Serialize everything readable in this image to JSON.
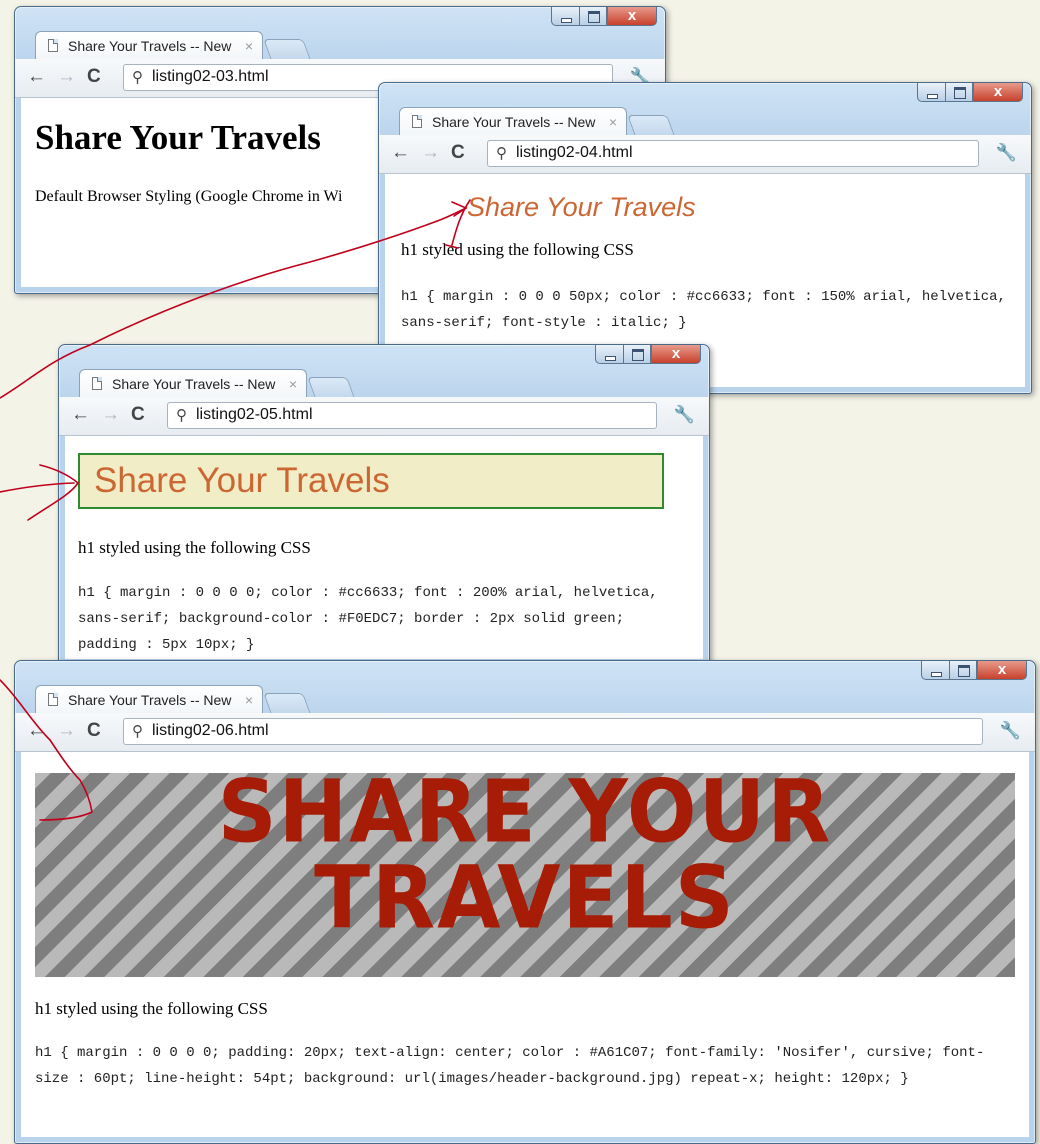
{
  "windows": [
    {
      "tab_title": "Share Your Travels -- New",
      "url": "listing02-03.html",
      "heading": "Share Your Travels",
      "text": "Default Browser Styling (Google Chrome in Wi"
    },
    {
      "tab_title": "Share Your Travels -- New",
      "url": "listing02-04.html",
      "heading": "Share Your Travels",
      "text": "h1 styled using the following CSS",
      "css": "h1 { margin : 0 0 0 50px; color : #cc6633; font : 150% arial, helvetica, sans-serif; font-style : italic; }"
    },
    {
      "tab_title": "Share Your Travels -- New",
      "url": "listing02-05.html",
      "heading": "Share Your Travels",
      "text": "h1 styled using the following CSS",
      "css": "h1 { margin : 0 0 0 0; color : #cc6633; font : 200% arial, helvetica, sans-serif; background-color : #F0EDC7; border : 2px solid green; padding : 5px 10px; }"
    },
    {
      "tab_title": "Share Your Travels -- New",
      "url": "listing02-06.html",
      "heading_line1": "SHARE YOUR",
      "heading_line2": "TRAVELS",
      "text": "h1 styled using the following CSS",
      "css": "h1 { margin : 0 0 0 0; padding: 20px; text-align: center; color : #A61C07; font-family: 'Nosifer', cursive; font-size : 60pt; line-height: 54pt; background: url(images/header-background.jpg) repeat-x; height: 120px; }"
    }
  ],
  "icons": {
    "back": "←",
    "forward": "→",
    "reload": "C",
    "search": "⚲",
    "wrench": "🔧",
    "close": "x",
    "tab_close": "×"
  },
  "colors": {
    "orange": "#cc6633",
    "beige": "#F0EDC7",
    "green_border": "#2e8b2e",
    "red_heading": "#A61C07",
    "annotation_red": "#c0001a"
  }
}
